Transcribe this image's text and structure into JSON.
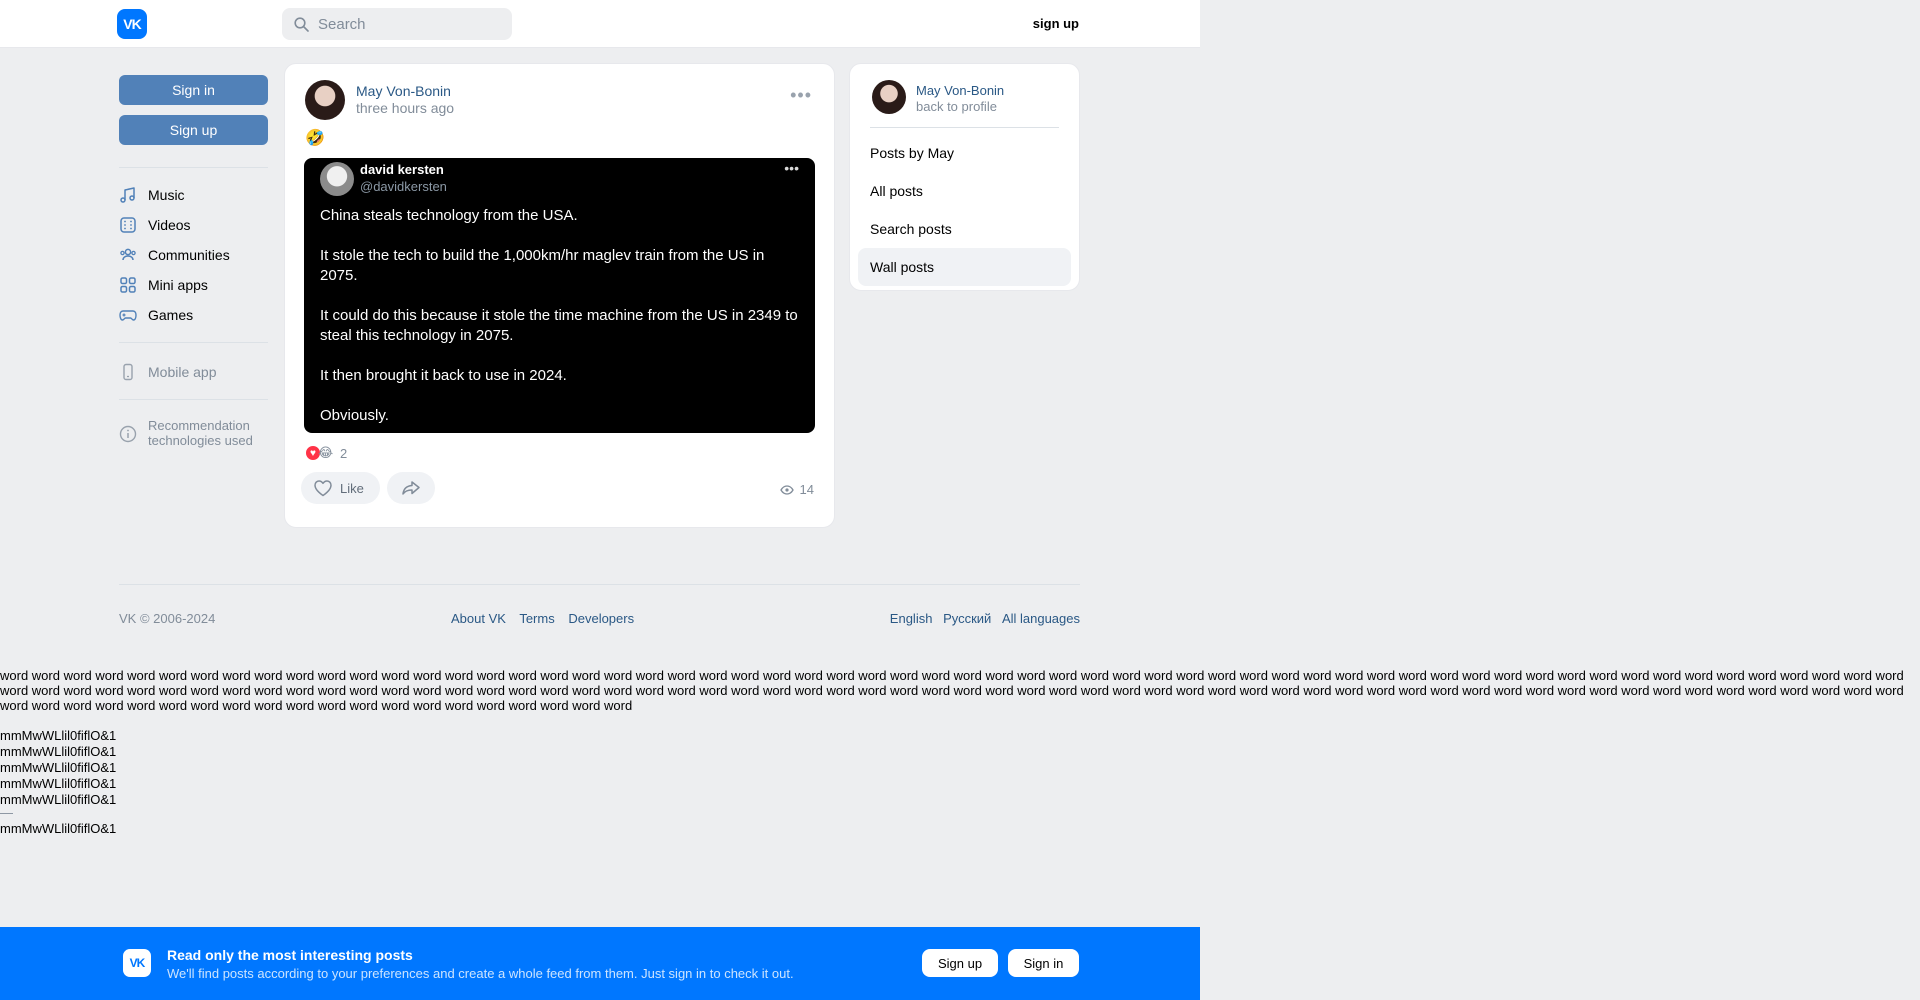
{
  "header": {
    "logo_text": "VK",
    "search_placeholder": "Search",
    "signup_label": "sign up"
  },
  "leftnav": {
    "signin_label": "Sign in",
    "signup_label": "Sign up",
    "items": [
      {
        "label": "Music",
        "icon": "music-icon"
      },
      {
        "label": "Videos",
        "icon": "video-icon"
      },
      {
        "label": "Communities",
        "icon": "communities-icon"
      },
      {
        "label": "Mini apps",
        "icon": "mini-apps-icon"
      },
      {
        "label": "Games",
        "icon": "gamepad-icon"
      }
    ],
    "mobile_app_label": "Mobile app",
    "recommendation_label": "Recommendation technologies used"
  },
  "post": {
    "author": "May Von-Bonin",
    "time": "three hours ago",
    "emoji": "🤣",
    "tweet": {
      "name": "david kersten",
      "handle": "@davidkersten",
      "paragraphs": [
        "China steals technology from the USA.",
        "It stole the tech to build the 1,000km/hr maglev train from the US in 2075.",
        "It could do this because it stole the time machine from the US in 2349 to steal this technology in 2075.",
        "It then brought it back to use in 2024.",
        "Obviously."
      ]
    },
    "reaction_count": "2",
    "like_label": "Like",
    "views": "14"
  },
  "rightcard": {
    "name": "May Von-Bonin",
    "back_label": "back to profile",
    "menu": [
      {
        "label": "Posts by May",
        "active": false
      },
      {
        "label": "All posts",
        "active": false
      },
      {
        "label": "Search posts",
        "active": false
      },
      {
        "label": "Wall posts",
        "active": true
      }
    ]
  },
  "footer": {
    "vk": "VK",
    "copyright": "© 2006-2024",
    "links": [
      "About VK",
      "Terms",
      "Developers"
    ],
    "languages": [
      "English",
      "Русский",
      "All languages"
    ]
  },
  "debug": {
    "words": "word word word word word word word word word word word word word word word word word word word word word word word word word word word word word word word word word word word word word word word word word word word word word word word word word word word word word word word word word word word word word word word word word word word word word word word word word word word word word word word word word word word word word word word word word word word word word word word word word word word word word word word word word word word word word word word word word word word word word word word word word word word word word word word word word word word word word word word word word word word word",
    "line": "mmMwWLlil0fiflO&1",
    "dash": "—"
  },
  "banner": {
    "logo_text": "VK",
    "title": "Read only the most interesting posts",
    "subtitle": "We'll find posts according to your preferences and create a whole feed from them. Just sign in to check it out.",
    "signup_label": "Sign up",
    "signin_label": "Sign in"
  }
}
